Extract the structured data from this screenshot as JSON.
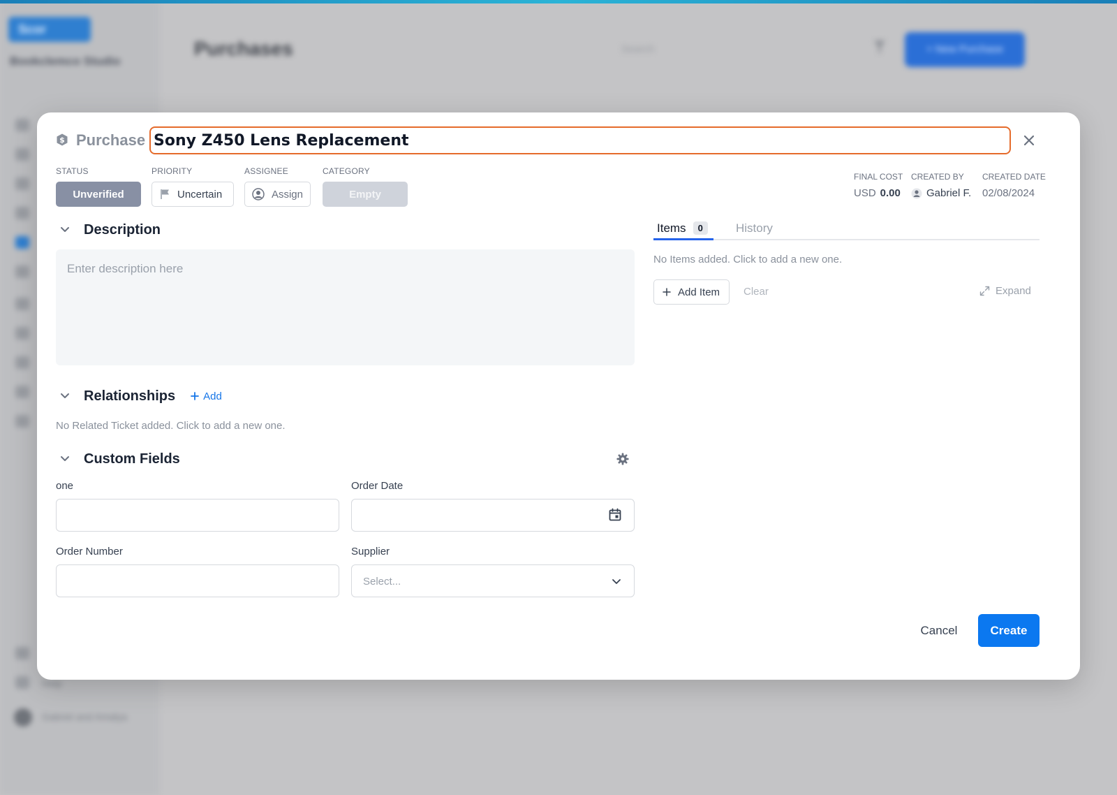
{
  "background": {
    "logo_text": "Scor",
    "studio_name": "Bookclemco Studio",
    "page_title": "Purchases",
    "search_placeholder": "Search",
    "new_button_label": "+ New Purchase",
    "bottom_items": [
      "Help",
      "Gabriel and Amalya"
    ]
  },
  "modal": {
    "type_label": "Purchase",
    "title_value": "Sony Z450 Lens Replacement",
    "meta": {
      "status_label": "STATUS",
      "status_value": "Unverified",
      "priority_label": "PRIORITY",
      "priority_value": "Uncertain",
      "assignee_label": "ASSIGNEE",
      "assignee_value": "Assign",
      "category_label": "CATEGORY",
      "category_value": "Empty",
      "final_cost_label": "FINAL COST",
      "final_cost_currency": "USD",
      "final_cost_value": "0.00",
      "created_by_label": "CREATED BY",
      "created_by_value": "Gabriel F.",
      "created_date_label": "CREATED DATE",
      "created_date_value": "02/08/2024"
    },
    "description": {
      "title": "Description",
      "placeholder": "Enter description here"
    },
    "relationships": {
      "title": "Relationships",
      "add_label": "Add",
      "empty_text": "No Related Ticket added. Click to add a new one."
    },
    "custom_fields": {
      "title": "Custom Fields",
      "fields": [
        {
          "label": "one",
          "value": ""
        },
        {
          "label": "Order Date",
          "value": ""
        },
        {
          "label": "Order Number",
          "value": ""
        },
        {
          "label": "Supplier",
          "placeholder": "Select..."
        }
      ]
    },
    "items_panel": {
      "tab_items": "Items",
      "items_count": "0",
      "tab_history": "History",
      "empty_text": "No Items added. Click to add a new one.",
      "add_item_label": "Add Item",
      "clear_label": "Clear",
      "expand_label": "Expand"
    },
    "actions": {
      "cancel_label": "Cancel",
      "create_label": "Create"
    }
  },
  "colors": {
    "accent": "#0b78f0",
    "title_border": "#e56b2b",
    "status_pill": "#8890a4"
  }
}
